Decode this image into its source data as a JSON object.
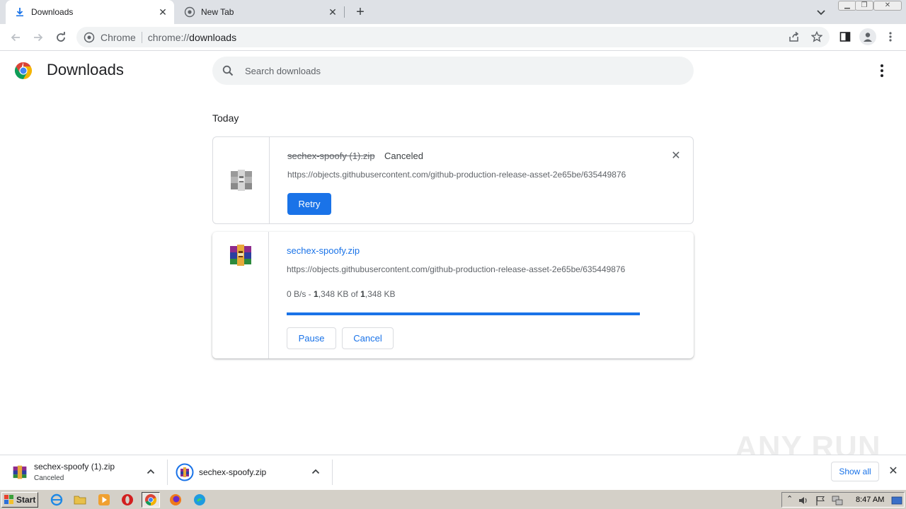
{
  "browser": {
    "tabs": [
      {
        "title": "Downloads",
        "icon": "download-icon",
        "active": true
      },
      {
        "title": "New Tab",
        "icon": "globe-icon",
        "active": false
      }
    ],
    "omnibox": {
      "site_label": "Chrome",
      "url_scheme": "chrome://",
      "url_host": "downloads"
    }
  },
  "page": {
    "title": "Downloads",
    "search_placeholder": "Search downloads",
    "section": "Today"
  },
  "downloads": [
    {
      "filename": "sechex-spoofy (1).zip",
      "status": "Canceled",
      "url": "https://objects.githubusercontent.com/github-production-release-asset-2e65be/635449876",
      "action_primary": "Retry",
      "icon": "archive-icon-grayscale"
    },
    {
      "filename": "sechex-spoofy.zip",
      "url": "https://objects.githubusercontent.com/github-production-release-asset-2e65be/635449876",
      "progress_prefix": "0 B/s - ",
      "received_bold": "1",
      "received_rest": ",348 KB of ",
      "total_bold": "1",
      "total_rest": ",348 KB",
      "progress_fraction": 1.0,
      "action_pause": "Pause",
      "action_cancel": "Cancel",
      "icon": "winrar-archive-icon"
    }
  ],
  "shelf": {
    "items": [
      {
        "name": "sechex-spoofy (1).zip",
        "status": "Canceled"
      },
      {
        "name": "sechex-spoofy.zip",
        "status": ""
      }
    ],
    "show_all": "Show all"
  },
  "watermark": "ANY RUN",
  "taskbar": {
    "start": "Start",
    "clock": "8:47 AM"
  },
  "colors": {
    "accent": "#1a73e8",
    "tabstrip": "#dee1e6",
    "taskbar": "#d4d0c8"
  }
}
